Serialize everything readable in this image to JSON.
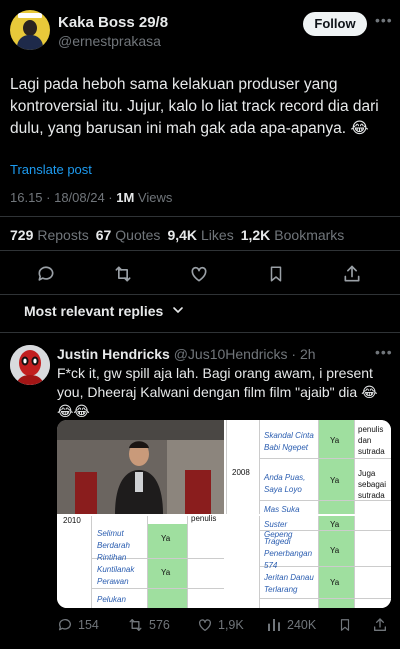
{
  "post": {
    "author_name": "Kaka Boss 29/8",
    "author_handle": "@ernestprakasa",
    "follow_label": "Follow",
    "text": "Lagi pada heboh sama kelakuan produser yang kontroversial itu. Jujur, kalo lo liat track record dia dari dulu, yang barusan ini mah gak ada apa-apanya. 😂",
    "translate_label": "Translate post",
    "timestamp": "16.15 · 18/08/24 · ",
    "views_count": "1M",
    "views_label": " Views",
    "stats": {
      "reposts_count": "729",
      "reposts_label": "Reposts",
      "quotes_count": "67",
      "quotes_label": "Quotes",
      "likes_count": "9,4K",
      "likes_label": "Likes",
      "bookmarks_count": "1,2K",
      "bookmarks_label": "Bookmarks"
    }
  },
  "replies_sort_label": "Most relevant replies",
  "reply": {
    "author_name": "Justin Hendricks",
    "author_handle": "@Jus10Hendricks",
    "time": "· 2h",
    "text": "F*ck it, gw spill aja lah. Bagi orang awam, i present you, Dheeraj Kalwani dengan film film \"ajaib\" dia 😂😂😂",
    "table_right": {
      "row1_title": "Skandal Cinta Babi Ngepet",
      "row1_note": "penulis dan sutrada",
      "year": "2008",
      "row2_title": "Anda Puas, Saya Loyo",
      "row2_note": "Juga sebagai sutrada",
      "row3_title": "Mas Suka Bangkinya",
      "row4_title": "Suster Gepeng",
      "row5_title": "Tragedi Penerbangan 574",
      "row6_title": "Jeritan Danau Terlarang",
      "ya": "Ya"
    },
    "table_left": {
      "year": "2010",
      "note": "penulis",
      "row1_title": "Selimut Berdarah",
      "row2_title": "Rintihan Kuntilanak Perawan",
      "row3_title": "Pelukan",
      "ya": "Ya"
    },
    "actions": {
      "replies": "154",
      "reposts": "576",
      "likes": "1,9K",
      "views": "240K"
    }
  },
  "colors": {
    "background": "#000000",
    "text": "#e7e9ea",
    "muted": "#71767b",
    "link": "#1d9bf0",
    "divider": "#2f3336"
  },
  "icons": [
    "reply-icon",
    "repost-icon",
    "like-icon",
    "bookmark-icon",
    "share-icon",
    "chevron-down-icon",
    "views-icon",
    "more-icon"
  ]
}
